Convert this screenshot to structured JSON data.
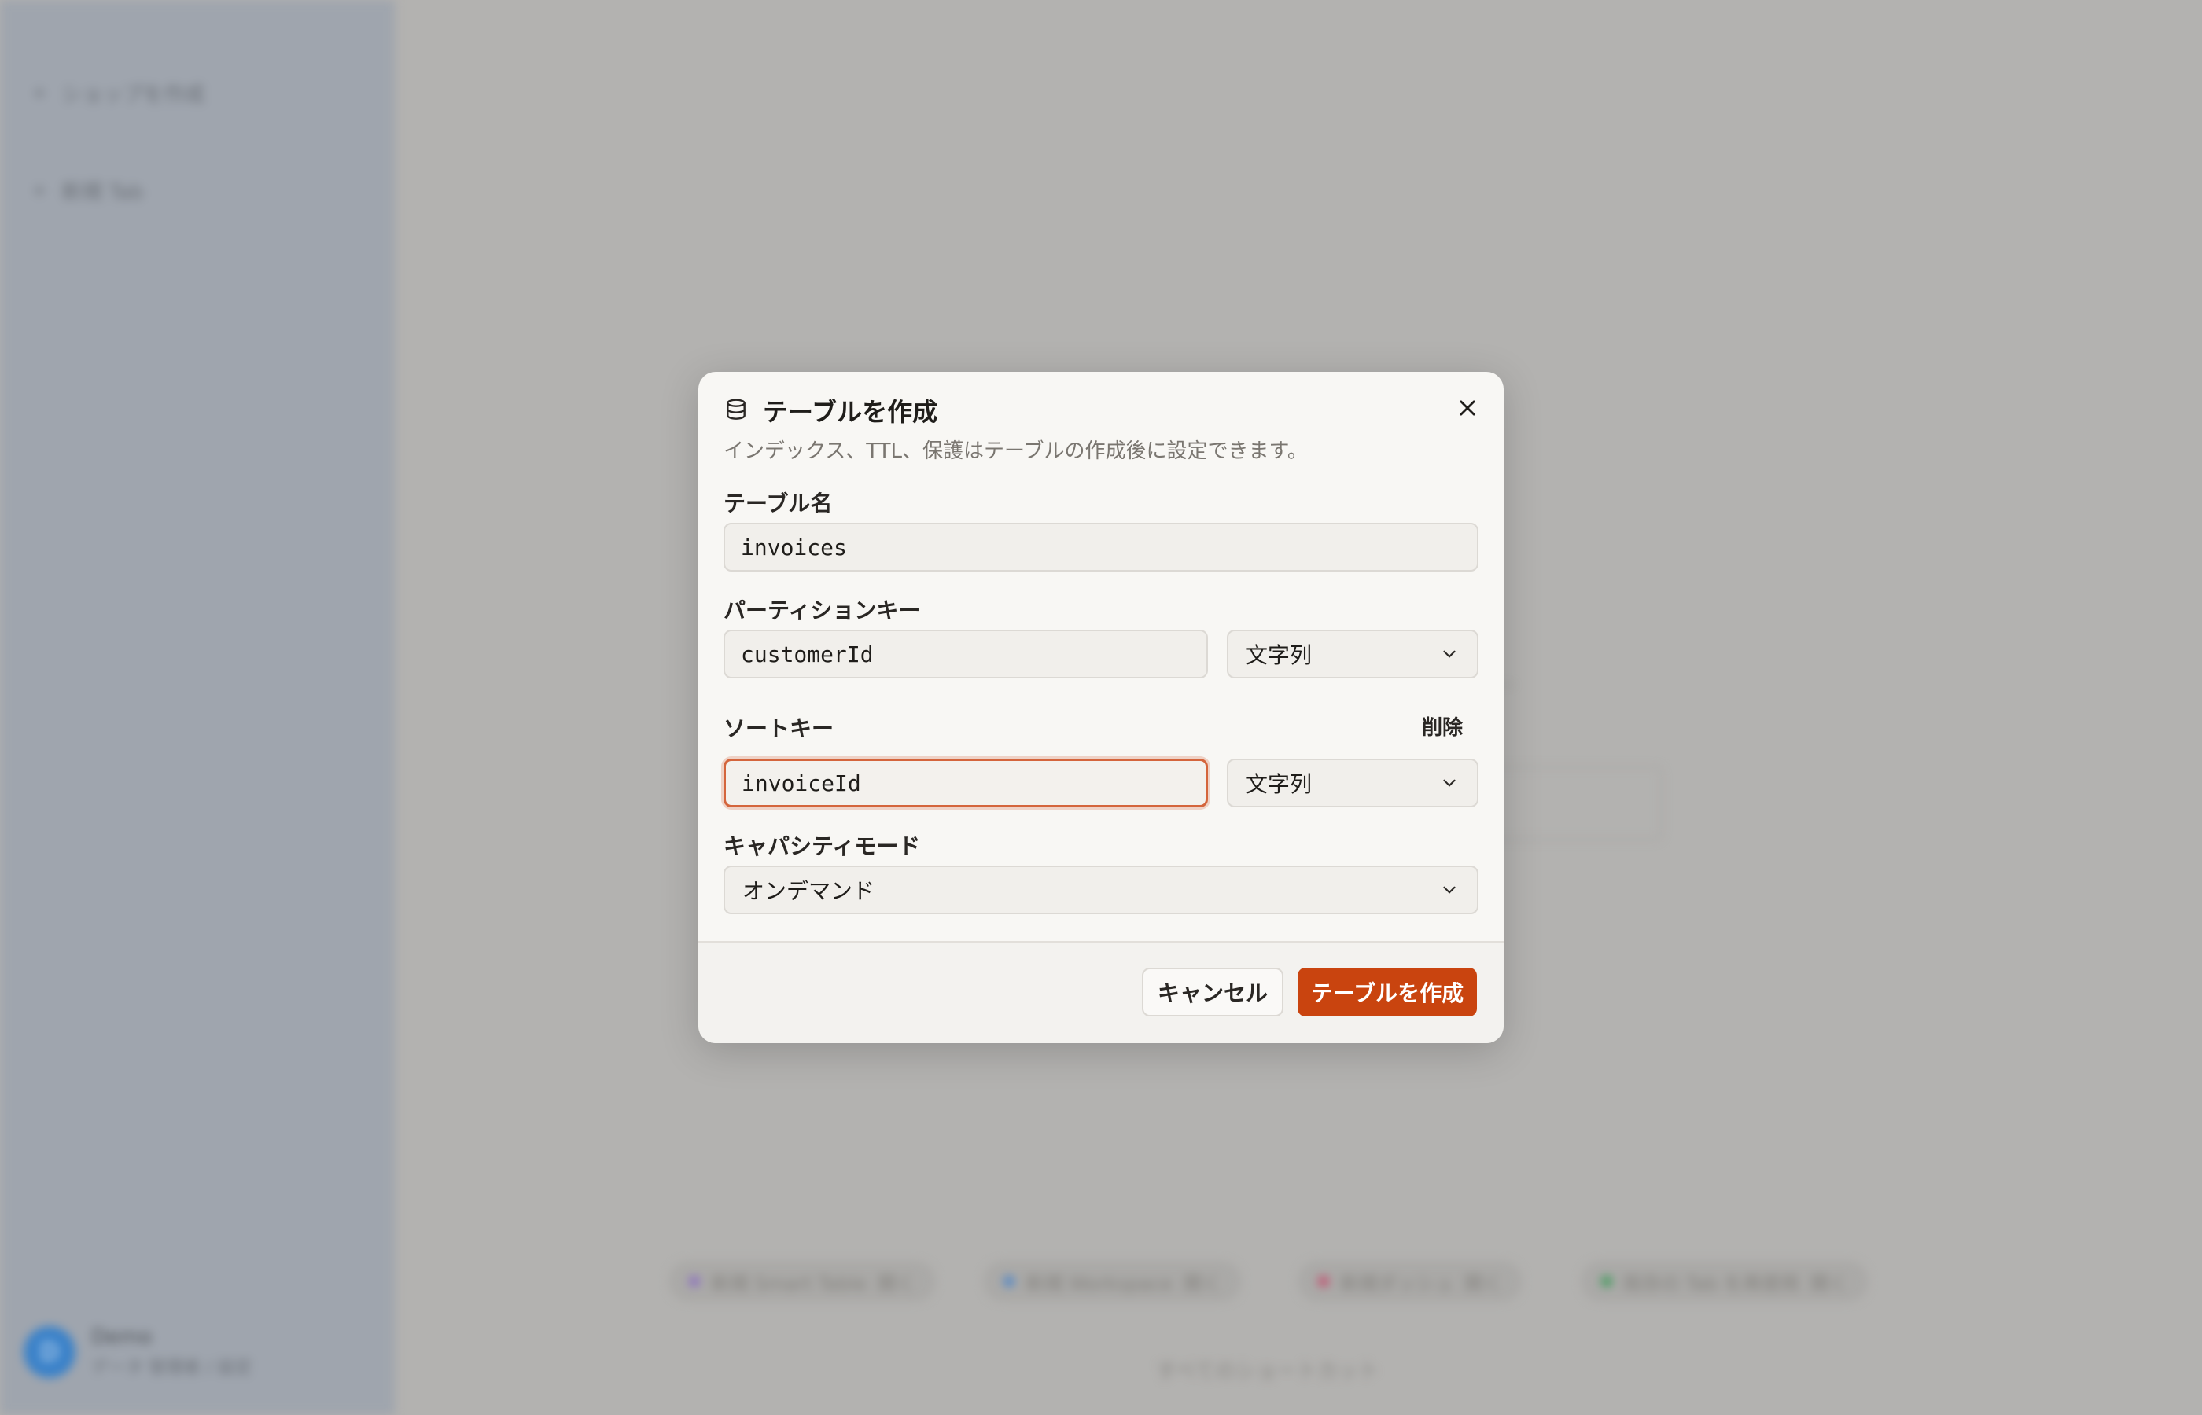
{
  "background": {
    "sidebar": {
      "items": [
        {
          "label": "ショップを作成"
        },
        {
          "label": "新規 Tab"
        }
      ],
      "user": {
        "initial": "D",
        "name": "Demo",
        "subtitle": "データ 管理者 / 設定"
      }
    },
    "main_hint_text": "…",
    "chips": [
      {
        "label": "新規 Smart Table",
        "shortcut": "開く",
        "color": "#8b6fc0"
      },
      {
        "label": "新規 Workspace",
        "shortcut": "開く",
        "color": "#4f86c8"
      },
      {
        "label": "新規ダッシュ",
        "shortcut": "開く",
        "color": "#c25170"
      },
      {
        "label": "既存の Tab を再使用",
        "shortcut": "開く",
        "color": "#3f9a5a"
      }
    ],
    "footer_text": "すべてのショートカット"
  },
  "dialog": {
    "icon": "database-icon",
    "title": "テーブルを作成",
    "description": "インデックス、TTL、保護はテーブルの作成後に設定できます。",
    "table_name": {
      "label": "テーブル名",
      "value": "invoices"
    },
    "partition_key": {
      "label": "パーティションキー",
      "value": "customerId",
      "type": "文字列"
    },
    "sort_key": {
      "label": "ソートキー",
      "remove_label": "削除",
      "value": "invoiceId",
      "type": "文字列"
    },
    "capacity_mode": {
      "label": "キャパシティモード",
      "value": "オンデマンド"
    },
    "cancel_label": "キャンセル",
    "submit_label": "テーブルを作成",
    "accent_color": "#c9440f",
    "focus_color": "#d4653c"
  }
}
